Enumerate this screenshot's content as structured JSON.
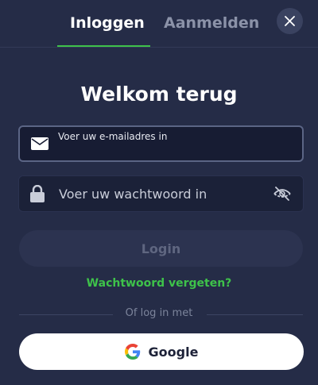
{
  "tabs": [
    {
      "label": "Inloggen",
      "active": true
    },
    {
      "label": "Aanmelden",
      "active": false
    }
  ],
  "title": "Welkom terug",
  "email": {
    "placeholder": "Voer uw e-mailadres in",
    "value": "",
    "icon": "mail-icon"
  },
  "password": {
    "placeholder": "Voer uw wachtwoord in",
    "value": "",
    "icon": "lock-icon",
    "toggle_icon": "eye-off-icon"
  },
  "login_label": "Login",
  "forgot_label": "Wachtwoord vergeten?",
  "divider_label": "Of log in met",
  "google_label": "Google",
  "colors": {
    "background": "#252c47",
    "accent": "#3ec24a",
    "input_bg": "#1b2138",
    "button_disabled": "#2c3350"
  }
}
